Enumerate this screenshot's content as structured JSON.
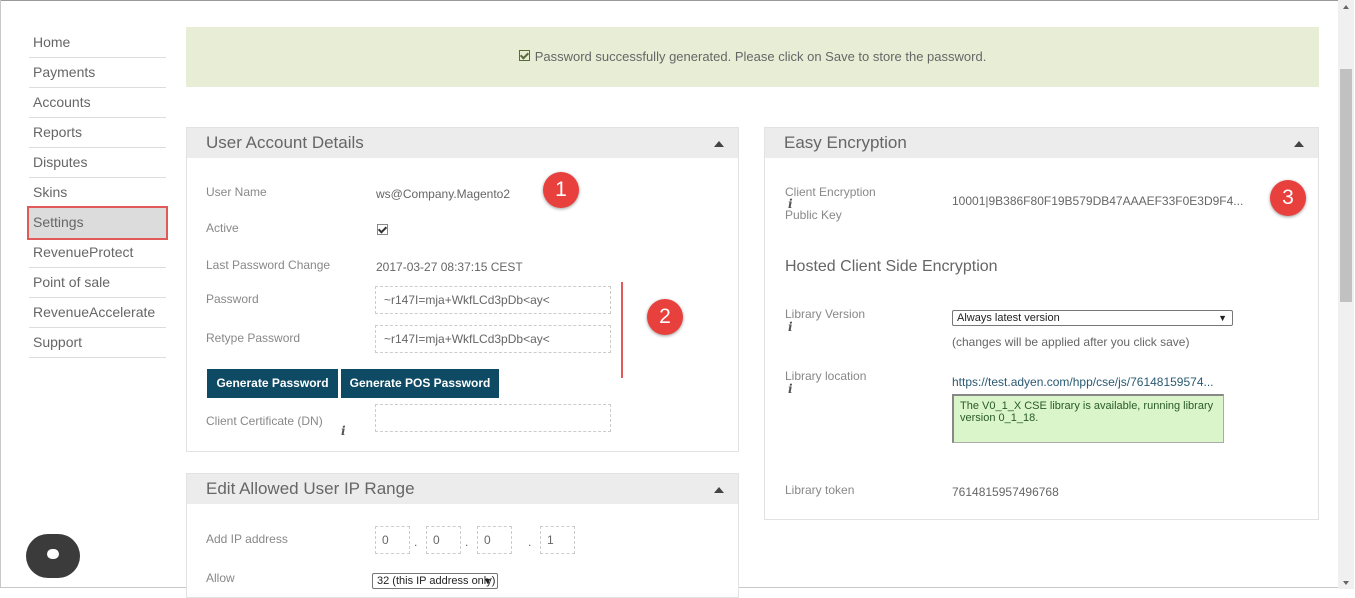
{
  "sidebar": {
    "items": [
      {
        "label": "Home"
      },
      {
        "label": "Payments"
      },
      {
        "label": "Accounts"
      },
      {
        "label": "Reports"
      },
      {
        "label": "Disputes"
      },
      {
        "label": "Skins"
      },
      {
        "label": "Settings",
        "active": true
      },
      {
        "label": "RevenueProtect"
      },
      {
        "label": "Point of sale"
      },
      {
        "label": "RevenueAccelerate"
      },
      {
        "label": "Support"
      }
    ]
  },
  "alert": {
    "message": "Password successfully generated. Please click on Save to store the password.",
    "background": "#e8eed6"
  },
  "user_account": {
    "title": "User Account Details",
    "user_name_label": "User Name",
    "user_name_value": "ws@Company.Magento2",
    "active_label": "Active",
    "active_checked": true,
    "last_change_label": "Last Password Change",
    "last_change_value": "2017-03-27 08:37:15 CEST",
    "password_label": "Password",
    "password_value": "~r147I=mja+WkfLCd3pDb<ay<",
    "retype_label": "Retype Password",
    "retype_value": "~r147I=mja+WkfLCd3pDb<ay<",
    "generate_password": "Generate Password",
    "generate_pos_password": "Generate POS Password",
    "client_cert_label": "Client Certificate (DN)",
    "client_cert_value": "",
    "info_icon": "i"
  },
  "ip_range": {
    "title": "Edit Allowed User IP Range",
    "add_ip_label": "Add IP address",
    "ip_octets": [
      "0",
      "0",
      "0",
      "1"
    ],
    "separator": ".",
    "allow_label": "Allow",
    "allow_value": "32 (this IP address only)",
    "select_arrow": "▼"
  },
  "encryption": {
    "title": "Easy Encryption",
    "client_key_label_1": "Client Encryption",
    "client_key_label_2": "Public Key",
    "client_key_value": "10001|9B386F80F19B579DB47AAAEF33F0E3D9F4...",
    "hosted_title": "Hosted Client Side Encryption",
    "library_version_label": "Library Version",
    "library_version_value": "Always latest version",
    "library_version_note": "(changes will be applied after you click save)",
    "library_location_label": "Library location",
    "library_location_value": "https://test.adyen.com/hpp/cse/js/76148159574...",
    "library_status": "The V0_1_X CSE library is available, running library version 0_1_18.",
    "library_token_label": "Library token",
    "library_token_value": "7614815957496768"
  },
  "badges": [
    "1",
    "2",
    "3"
  ],
  "colors": {
    "button": "#0f4a64",
    "badge": "#e8403c",
    "highlight": "#e05a5a",
    "status_box": "#d9f5c9"
  }
}
